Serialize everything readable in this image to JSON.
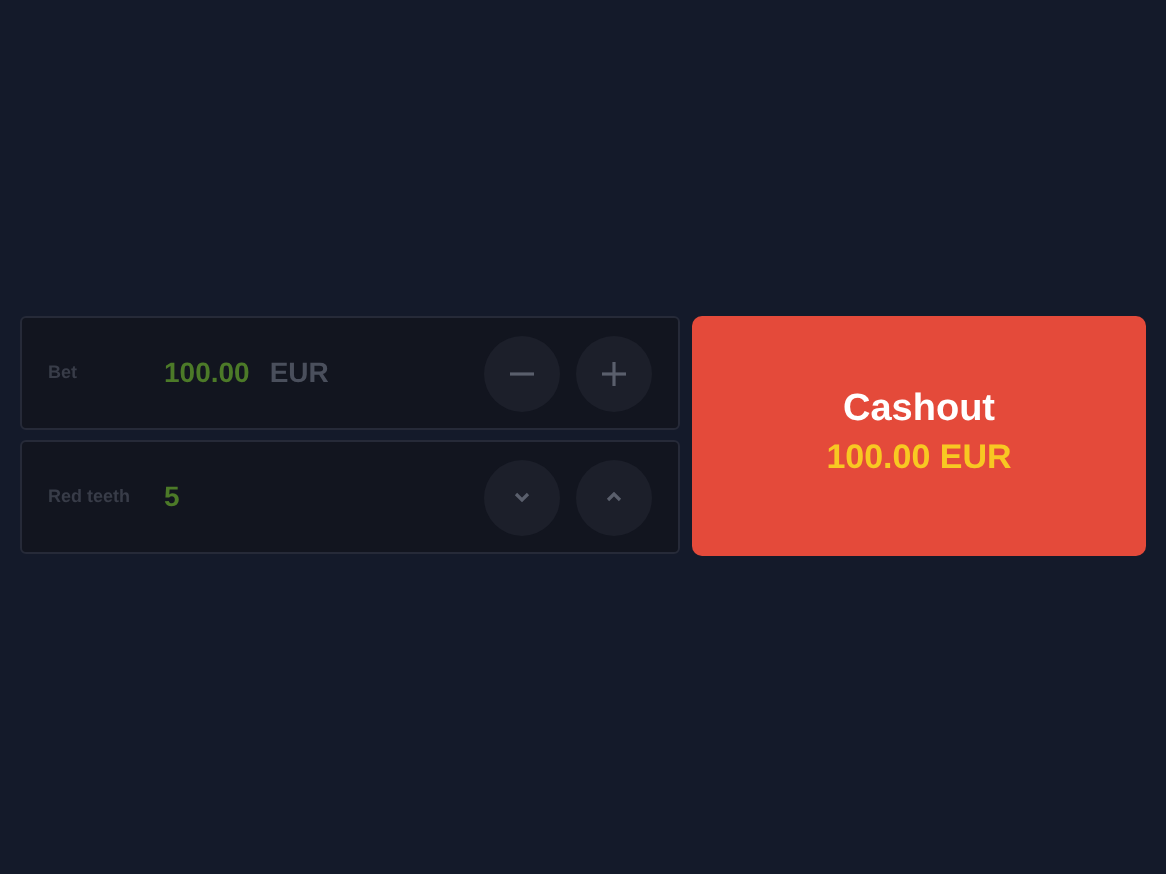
{
  "settings": {
    "disabled": true,
    "rows": [
      {
        "kind": "amount",
        "label": "Bet",
        "value": "100.00",
        "currency": "EUR"
      },
      {
        "kind": "count",
        "label": "Red teeth",
        "value": "5"
      }
    ]
  },
  "cashout": {
    "label": "Cashout",
    "amount": "100.00",
    "currency": "EUR"
  }
}
